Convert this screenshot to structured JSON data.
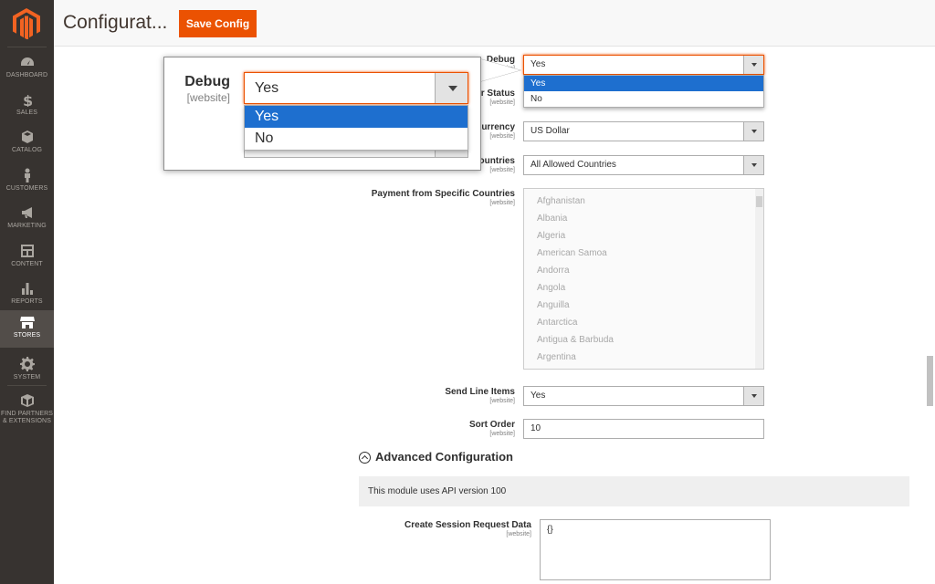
{
  "sidebar": {
    "items": [
      {
        "label": "DASHBOARD",
        "icon": "dashboard-icon"
      },
      {
        "label": "SALES",
        "icon": "dollar-icon"
      },
      {
        "label": "CATALOG",
        "icon": "cube-icon"
      },
      {
        "label": "CUSTOMERS",
        "icon": "person-icon"
      },
      {
        "label": "MARKETING",
        "icon": "megaphone-icon"
      },
      {
        "label": "CONTENT",
        "icon": "layout-icon"
      },
      {
        "label": "REPORTS",
        "icon": "bar-chart-icon"
      },
      {
        "label": "STORES",
        "icon": "store-icon"
      },
      {
        "label": "SYSTEM",
        "icon": "gear-icon"
      },
      {
        "label": "FIND PARTNERS",
        "label2": "& EXTENSIONS",
        "icon": "box-icon"
      }
    ],
    "active": "STORES"
  },
  "header": {
    "title": "Configurat...",
    "save_label": "Save Config"
  },
  "form": {
    "debug": {
      "label": "Debug",
      "scope": "[website]",
      "value": "Yes",
      "options": [
        "Yes",
        "No"
      ]
    },
    "order_status": {
      "label_partial": "er Status",
      "scope": "[website]"
    },
    "currency": {
      "label_partial": "Currency",
      "scope": "[website]",
      "value": "US Dollar"
    },
    "countries": {
      "label_partial": "ountries",
      "scope": "[website]",
      "value": "All Allowed Countries"
    },
    "specific_countries": {
      "label": "Payment from Specific Countries",
      "scope": "[website]",
      "options": [
        "Afghanistan",
        "Albania",
        "Algeria",
        "American Samoa",
        "Andorra",
        "Angola",
        "Anguilla",
        "Antarctica",
        "Antigua & Barbuda",
        "Argentina"
      ]
    },
    "send_line_items": {
      "label": "Send Line Items",
      "scope": "[website]",
      "value": "Yes"
    },
    "sort_order": {
      "label": "Sort Order",
      "scope": "[website]",
      "value": "10"
    },
    "advanced": {
      "title": "Advanced Configuration",
      "notice": "This module uses API version 100"
    },
    "session_request": {
      "label": "Create Session Request Data",
      "scope": "[website]",
      "value": "{}"
    }
  },
  "callout": {
    "label": "Debug",
    "scope": "[website]",
    "value": "Yes",
    "options": [
      "Yes",
      "No"
    ]
  },
  "colors": {
    "accent": "#eb5202",
    "sidebar": "#373330",
    "selected_option": "#1e6fcf"
  }
}
